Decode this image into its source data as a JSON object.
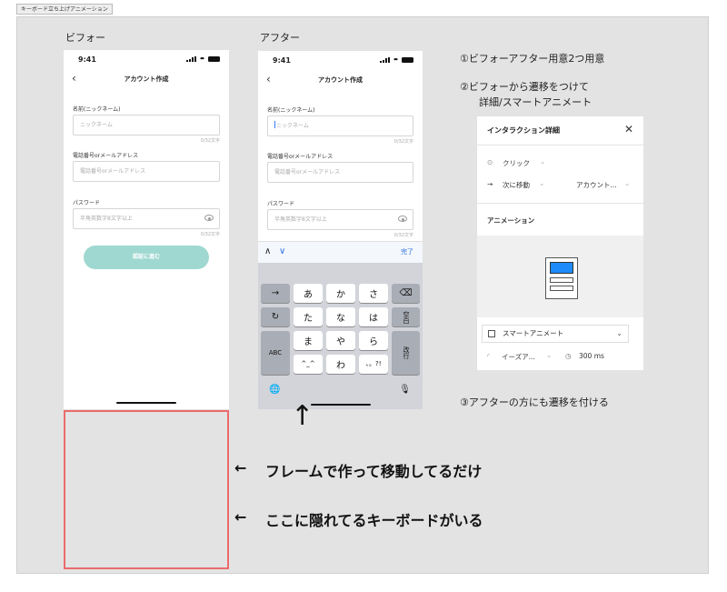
{
  "frame_tab": "キーボード立ち上げアニメーション",
  "before": {
    "label": "ビフォー",
    "time": "9:41",
    "title": "アカウント作成",
    "back": "‹",
    "fields": [
      {
        "label": "名前(ニックネーム)",
        "placeholder": "ニックネーム",
        "counter": "0/32文字"
      },
      {
        "label": "電話番号orメールアドレス",
        "placeholder": "電話番号orメールアドレス",
        "counter": ""
      },
      {
        "label": "パスワード",
        "placeholder": "半角英数字8文字以上",
        "counter": "0/32文字"
      }
    ],
    "submit": "認証に進む"
  },
  "after": {
    "label": "アフター",
    "time": "9:41",
    "title": "アカウント作成",
    "back": "‹",
    "fields": [
      {
        "label": "名前(ニックネーム)",
        "placeholder": "ニックネーム",
        "counter": "0/32文字"
      },
      {
        "label": "電話番号orメールアドレス",
        "placeholder": "電話番号orメールアドレス",
        "counter": ""
      },
      {
        "label": "パスワード",
        "placeholder": "半角英数字8文字以上",
        "counter": "0/32文字"
      }
    ],
    "accessory": {
      "up": "∧",
      "down": "∨",
      "done": "完了"
    },
    "keys": {
      "row1": [
        "→",
        "あ",
        "か",
        "さ",
        "⌫"
      ],
      "row2": [
        "↻",
        "た",
        "な",
        "は",
        "空白"
      ],
      "row3": [
        "ABC",
        "ま",
        "や",
        "ら",
        "改行"
      ],
      "row4": [
        "^_^",
        "わ",
        "、。?!"
      ]
    },
    "globe": "🌐",
    "mic": "🎙"
  },
  "steps": {
    "step1": "①ビフォーアフター用意2つ用意",
    "step2_line1": "②ビフォーから遷移をつけて",
    "step2_line2": "詳細/スマートアニメート",
    "step3": "③アフターの方にも遷移を付ける"
  },
  "panel": {
    "title": "インタラクション詳細",
    "close": "✕",
    "trigger": "クリック",
    "action": "次に移動",
    "destination": "アカウント...",
    "animation_heading": "アニメーション",
    "animation_type": "スマートアニメート",
    "easing": "イーズア...",
    "duration": "300 ms"
  },
  "notes": {
    "arrow_up": "↑",
    "note1": "フレームで作って移動してるだけ",
    "note2": "ここに隠れてるキーボードがいる",
    "arrow_left": "←"
  },
  "colors": {
    "accent_teal": "#9fd8d1",
    "highlight_red": "#ec6a6a",
    "keyboard_bg": "#d2d4da",
    "blue": "#1d8cf8"
  }
}
